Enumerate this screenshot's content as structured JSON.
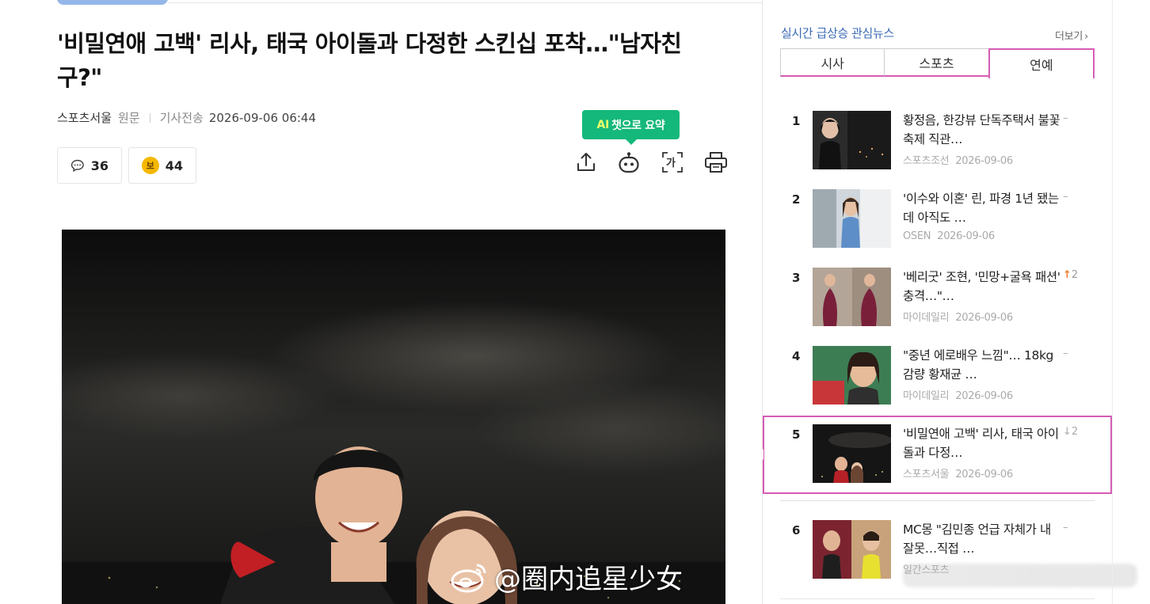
{
  "article": {
    "headline": "'비밀연애 고백' 리사, 태국 아이돌과 다정한 스킨십 포착…\"남자친구?\"",
    "press": "스포츠서울",
    "origin_label": "원문",
    "sent_label": "기사전송",
    "datetime": "2026-09-06 06:44",
    "comment_count": "36",
    "like_count": "44",
    "like_icon_glyph": "보",
    "ai_tooltip_ai": "AI",
    "ai_tooltip_text": "챗으로 요약",
    "font_tool_glyph": "가"
  },
  "watermark": {
    "text": "@圈内追星少女"
  },
  "sidebar": {
    "title": "실시간 급상승 관심뉴스",
    "more_label": "더보기",
    "tabs": [
      {
        "label": "시사",
        "active": false
      },
      {
        "label": "스포츠",
        "active": false
      },
      {
        "label": "연예",
        "active": true
      }
    ],
    "items": [
      {
        "rank": "1",
        "title": "황정음, 한강뷰 단독주택서 불꽃축제 직관…",
        "press": "스포츠조선",
        "date": "2026-09-06",
        "change": "–"
      },
      {
        "rank": "2",
        "title": "'이수와 이혼' 린, 파경 1년 됐는데 아직도 …",
        "press": "OSEN",
        "date": "2026-09-06",
        "change": "–"
      },
      {
        "rank": "3",
        "title": "'베리굿' 조현, '민망+굴욕 패션' 충격…\"…",
        "press": "마이데일리",
        "date": "2026-09-06",
        "change": "2",
        "direction": "up"
      },
      {
        "rank": "4",
        "title": "\"중년 에로배우 느낌\"… 18kg 감량 황재균 …",
        "press": "마이데일리",
        "date": "2026-09-06",
        "change": "–"
      },
      {
        "rank": "5",
        "title": "'비밀연애 고백' 리사, 태국 아이돌과 다정…",
        "press": "스포츠서울",
        "date": "2026-09-06",
        "change": "2",
        "direction": "down"
      },
      {
        "rank": "6",
        "title": "MC몽 \"김민종 언급 자체가 내 잘못…직접 …",
        "press": "일간스포츠",
        "date": "",
        "change": "–"
      }
    ]
  },
  "colors": {
    "accent_pink": "#d65cb5",
    "link_blue": "#3a6bb5",
    "ai_green": "#14b87a"
  }
}
